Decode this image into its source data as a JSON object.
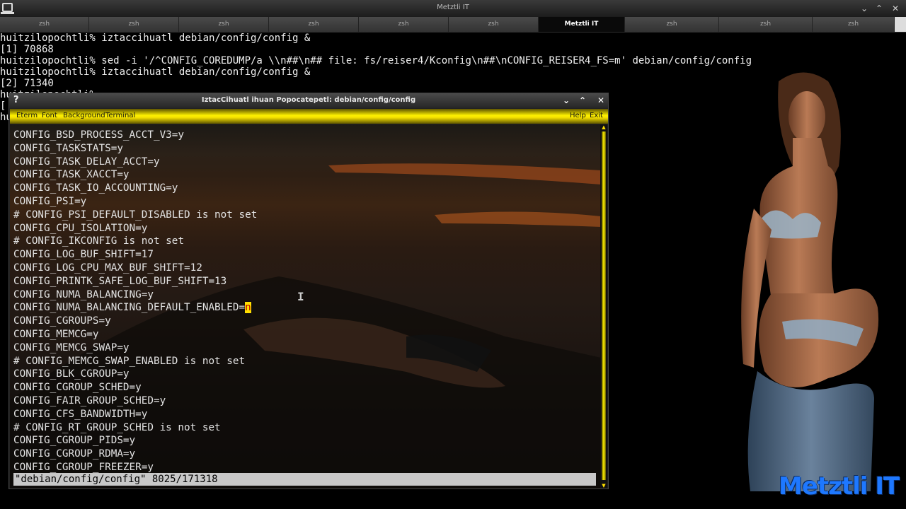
{
  "window": {
    "title": "Metztli IT"
  },
  "tabs": [
    {
      "label": "zsh"
    },
    {
      "label": "zsh"
    },
    {
      "label": "zsh"
    },
    {
      "label": "zsh"
    },
    {
      "label": "zsh"
    },
    {
      "label": "zsh"
    },
    {
      "label": "Metztli IT",
      "active": true
    },
    {
      "label": "zsh"
    },
    {
      "label": "zsh"
    },
    {
      "label": "zsh"
    }
  ],
  "shell": {
    "lines": [
      "huitzilopochtli% iztaccihuatl debian/config/config &",
      "[1] 70868",
      "huitzilopochtli% sed -i '/^CONFIG_COREDUMP/a \\\\n##\\n## file: fs/reiser4/Kconfig\\n##\\nCONFIG_REISER4_FS=m' debian/config/config",
      "huitzilopochtli% iztaccihuatl debian/config/config &",
      "[2] 71340",
      "huitzilopochtli% ",
      "[",
      "hu"
    ]
  },
  "eterm": {
    "title": "IztacCihuatl ihuan Popocatepetl: debian/config/config",
    "menu": [
      "Eterm",
      "Font",
      "Background",
      "Terminal"
    ],
    "menu_right": [
      "Help",
      "Exit"
    ],
    "lines": [
      "CONFIG_BSD_PROCESS_ACCT_V3=y",
      "CONFIG_TASKSTATS=y",
      "CONFIG_TASK_DELAY_ACCT=y",
      "CONFIG_TASK_XACCT=y",
      "CONFIG_TASK_IO_ACCOUNTING=y",
      "CONFIG_PSI=y",
      "# CONFIG_PSI_DEFAULT_DISABLED is not set",
      "CONFIG_CPU_ISOLATION=y",
      "# CONFIG_IKCONFIG is not set",
      "CONFIG_LOG_BUF_SHIFT=17",
      "CONFIG_LOG_CPU_MAX_BUF_SHIFT=12",
      "CONFIG_PRINTK_SAFE_LOG_BUF_SHIFT=13",
      "CONFIG_NUMA_BALANCING=y",
      "CONFIG_NUMA_BALANCING_DEFAULT_ENABLED=",
      "CONFIG_CGROUPS=y",
      "CONFIG_MEMCG=y",
      "CONFIG_MEMCG_SWAP=y",
      "# CONFIG_MEMCG_SWAP_ENABLED is not set",
      "CONFIG_BLK_CGROUP=y",
      "CONFIG_CGROUP_SCHED=y",
      "CONFIG_FAIR_GROUP_SCHED=y",
      "CONFIG_CFS_BANDWIDTH=y",
      "# CONFIG_RT_GROUP_SCHED is not set",
      "CONFIG_CGROUP_PIDS=y",
      "CONFIG_CGROUP_RDMA=y",
      "CONFIG_CGROUP_FREEZER=y"
    ],
    "cursor_char": "n",
    "status": "\"debian/config/config\" 8025/171318"
  },
  "brand": "Metztli IT",
  "colors": {
    "menubar": "#fff200",
    "cursor": "#ffe000",
    "brand": "#1e78ff"
  }
}
